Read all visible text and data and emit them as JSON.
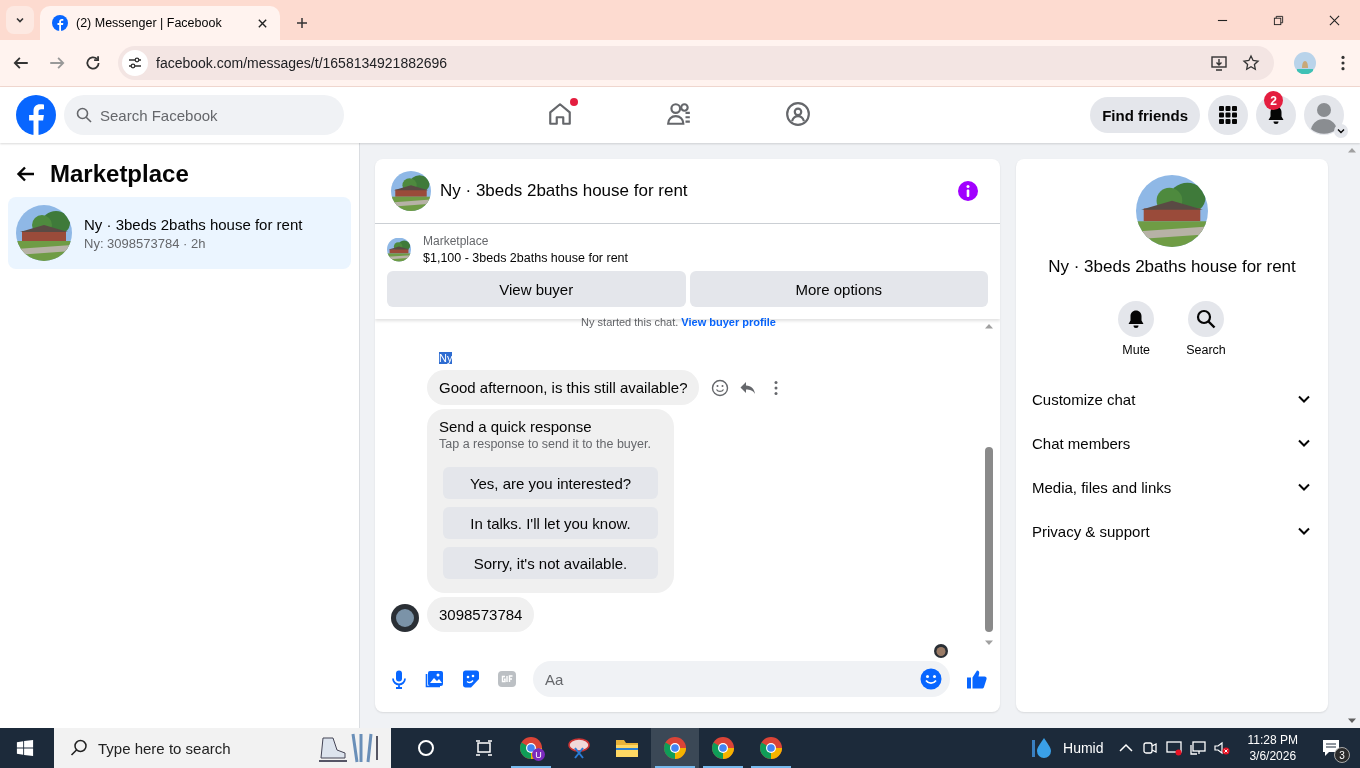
{
  "browser": {
    "tab": {
      "title": "(2) Messenger | Facebook",
      "selected": true
    },
    "url": "facebook.com/messages/t/1658134921882696"
  },
  "header": {
    "search": {
      "placeholder": "Search Facebook"
    },
    "nav": [
      {
        "kind": "home",
        "selected": false,
        "unread": true
      },
      {
        "kind": "friends",
        "selected": false,
        "unread": false
      },
      {
        "kind": "groups",
        "selected": false,
        "unread": false
      }
    ],
    "find_friends": "Find friends",
    "notifications_badge": "2"
  },
  "sidebar": {
    "title": "Marketplace",
    "conversations": [
      {
        "title": "Ny · 3beds 2baths house for rent",
        "subtitle": "Ny: 3098573784 · 2h",
        "selected": true
      }
    ]
  },
  "chat": {
    "title": "Ny · 3beds 2baths house for rent",
    "listing": {
      "source": "Marketplace",
      "text": "$1,100 - 3beds 2baths house for rent"
    },
    "actions": [
      "View buyer",
      "More options"
    ],
    "notice": {
      "text": "Ny started this chat.",
      "link": "View buyer profile"
    },
    "sender": {
      "name": "Ny",
      "highlighted": true
    },
    "messages": [
      {
        "kind": "text",
        "text": "Good afternoon, is this still available?",
        "avatar": false,
        "tools": true
      },
      {
        "kind": "quick_response",
        "title": "Send a quick response",
        "hint": "Tap a response to send it to the buyer.",
        "options": [
          "Yes, are you interested?",
          "In talks. I'll let you know.",
          "Sorry, it's not available."
        ]
      },
      {
        "kind": "text",
        "text": "3098573784",
        "avatar": true,
        "tools": false
      }
    ],
    "composer": {
      "placeholder": "Aa"
    }
  },
  "details": {
    "name": "Ny · 3beds 2baths house for rent",
    "actions": [
      {
        "kind": "mute",
        "label": "Mute"
      },
      {
        "kind": "search",
        "label": "Search"
      }
    ],
    "sections": [
      {
        "label": "Customize chat",
        "expanded": false
      },
      {
        "label": "Chat members",
        "expanded": false
      },
      {
        "label": "Media, files and links",
        "expanded": false
      },
      {
        "label": "Privacy & support",
        "expanded": false
      }
    ]
  },
  "taskbar": {
    "search": {
      "placeholder": "Type here to search"
    },
    "apps": [
      {
        "kind": "chrome",
        "badge": "U",
        "selected": false,
        "running": true
      },
      {
        "kind": "snip",
        "selected": false,
        "running": false
      },
      {
        "kind": "folder",
        "selected": false,
        "running": false
      },
      {
        "kind": "chrome",
        "selected": true,
        "running": true
      },
      {
        "kind": "chrome",
        "selected": false,
        "running": true
      },
      {
        "kind": "chrome",
        "selected": false,
        "running": true
      }
    ],
    "weather": "Humid",
    "time": "11:28 PM",
    "date": "3/6/2026",
    "notification_count": "3"
  }
}
